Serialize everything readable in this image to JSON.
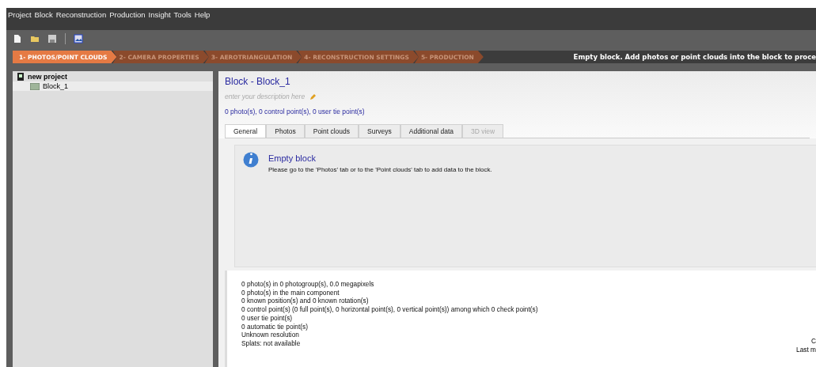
{
  "menu": [
    "Project",
    "Block",
    "Reconstruction",
    "Production",
    "Insight",
    "Tools",
    "Help"
  ],
  "steps": [
    {
      "label": "1- PHOTOS/POINT CLOUDS",
      "selected": true
    },
    {
      "label": "2- CAMERA PROPERTIES",
      "selected": false
    },
    {
      "label": "3- AEROTRIANGULATION",
      "selected": false
    },
    {
      "label": "4- RECONSTRUCTION SETTINGS",
      "selected": false
    },
    {
      "label": "5- PRODUCTION",
      "selected": false
    }
  ],
  "status_message": "Empty block. Add photos or point clouds into the block to proce",
  "tree": [
    {
      "label": "new project",
      "selected": false,
      "children": [
        {
          "label": "Block_1",
          "selected": true
        }
      ]
    }
  ],
  "block": {
    "title": "Block - Block_1",
    "description_hint": "enter your description here",
    "summary": "0 photo(s), 0 control point(s), 0 user tie point(s)",
    "tabs": [
      {
        "label": "General",
        "selected": true,
        "disabled": false
      },
      {
        "label": "Photos",
        "selected": false,
        "disabled": false
      },
      {
        "label": "Point clouds",
        "selected": false,
        "disabled": false
      },
      {
        "label": "Surveys",
        "selected": false,
        "disabled": false
      },
      {
        "label": "Additional data",
        "selected": false,
        "disabled": false
      },
      {
        "label": "3D view",
        "selected": false,
        "disabled": true
      }
    ],
    "info": {
      "title": "Empty block",
      "message": "Please go to the 'Photos' tab or to the 'Point clouds' tab to add data to the block."
    },
    "stats": [
      "0 photo(s) in 0 photogroup(s), 0.0 megapixels",
      "0 photo(s) in the main component",
      "0 known position(s) and 0 known rotation(s)",
      "0 control point(s) (0 full point(s), 0 horizontal point(s), 0 vertical point(s)) among which 0 check point(s)",
      "0 user tie point(s)",
      "0 automatic tie point(s)",
      "Unknown resolution",
      "Splats: not available"
    ],
    "side_lines": [
      "C",
      "Last m"
    ]
  }
}
